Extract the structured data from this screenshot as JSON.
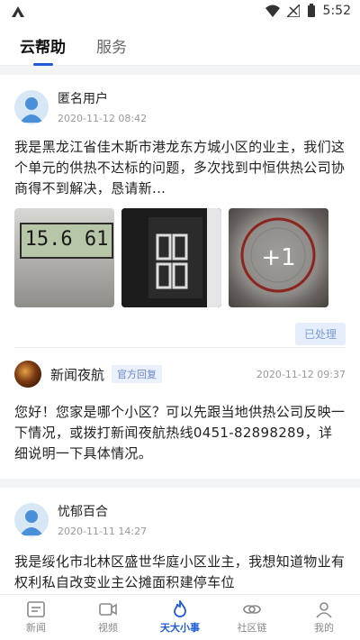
{
  "status_bar": {
    "time": "5:52"
  },
  "tabs": [
    {
      "label": "云帮助",
      "active": true
    },
    {
      "label": "服务",
      "active": false
    }
  ],
  "post1": {
    "user": "匿名用户",
    "time": "2020-11-12 08:42",
    "content": "我是黑龙江省佳木斯市港龙东方城小区的业主，我们这个单元的供热不达标的问题，多次找到中恒供热公司协商得不到解决，恳请新...",
    "image1_display": "15.6 61",
    "image3_overlay": "+1",
    "status": "已处理"
  },
  "reply": {
    "name": "新闻夜航",
    "badge": "官方回复",
    "time": "2020-11-12 09:37",
    "content": "您好！您家是哪个小区？可以先跟当地供热公司反映一下情况，或拨打新闻夜航热线0451-82898289，详细说明一下具体情况。"
  },
  "post2": {
    "user": "忧郁百合",
    "time": "2020-11-11 14:27",
    "content": "我是绥化市北林区盛世华庭小区业主，我想知道物业有权利私自改变业主公摊面积建停车位"
  },
  "bottom_nav": [
    {
      "label": "新闻",
      "icon": "news-icon",
      "active": false
    },
    {
      "label": "视频",
      "icon": "video-icon",
      "active": false
    },
    {
      "label": "天大小事",
      "icon": "flame-icon",
      "active": true
    },
    {
      "label": "社区链",
      "icon": "link-icon",
      "active": false
    },
    {
      "label": "我的",
      "icon": "profile-icon",
      "active": false
    }
  ],
  "colors": {
    "accent": "#1e5bd8",
    "badge_bg": "#e6eefc"
  }
}
